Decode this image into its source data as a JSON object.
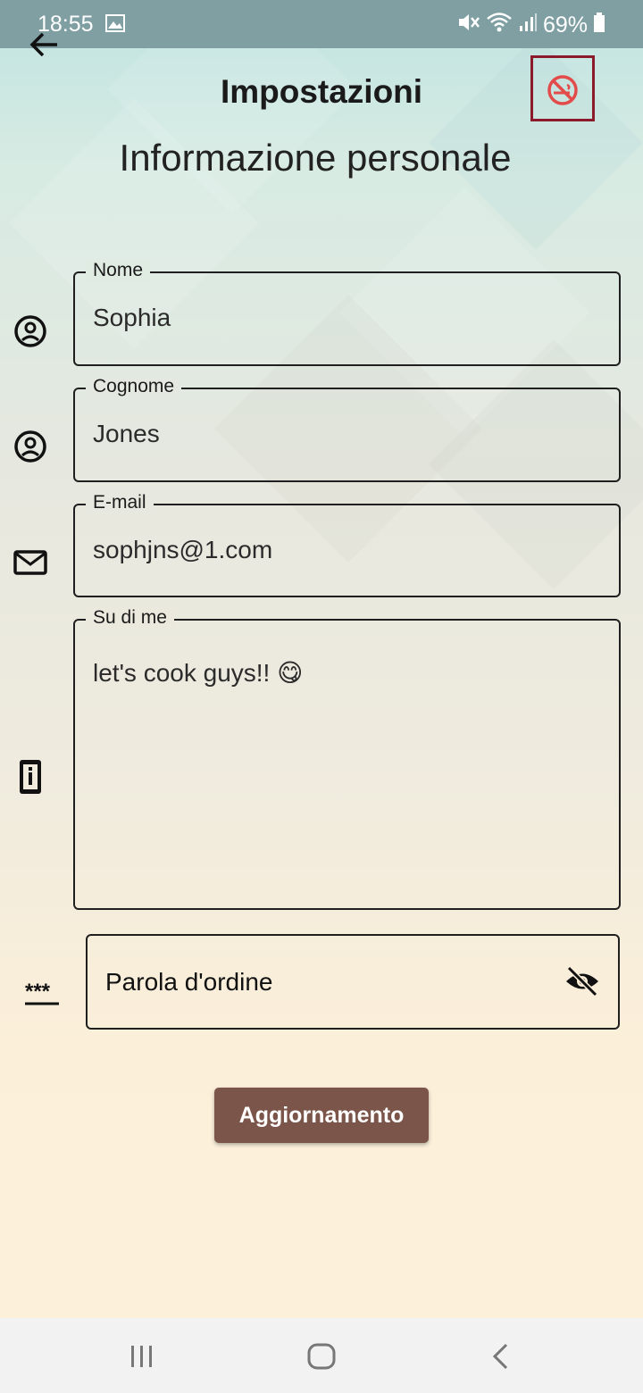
{
  "status_bar": {
    "time": "18:55",
    "battery": "69%",
    "icons": [
      "gallery-icon",
      "mute-icon",
      "wifi-icon",
      "signal-icon",
      "battery-icon"
    ]
  },
  "app_bar": {
    "title": "Impostazioni",
    "back_icon": "arrow-left-icon",
    "action_icon": "no-smoking-icon"
  },
  "section_title": "Informazione personale",
  "fields": {
    "first_name": {
      "label": "Nome",
      "value": "Sophia"
    },
    "last_name": {
      "label": "Cognome",
      "value": "Jones"
    },
    "email": {
      "label": "E-mail",
      "value": "sophjns@1.com"
    },
    "about": {
      "label": "Su di me",
      "value": "let's cook guys!! 😋"
    },
    "password": {
      "placeholder": "Parola d'ordine"
    }
  },
  "update_button": "Aggiornamento",
  "nav_bar": {
    "icons": [
      "recents-icon",
      "home-icon",
      "back-icon"
    ]
  },
  "colors": {
    "accent_button": "#7b5549",
    "highlight_box": "#8b1a2a",
    "warning_icon": "#e34b4b"
  }
}
